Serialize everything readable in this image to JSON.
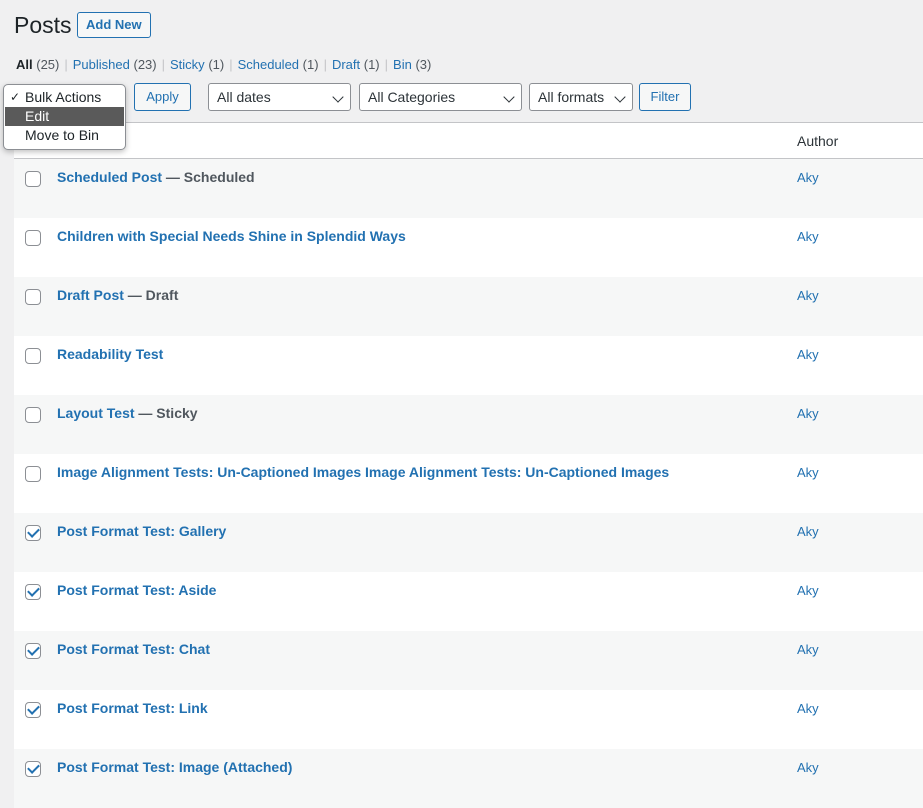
{
  "header": {
    "title": "Posts",
    "add_new": "Add New"
  },
  "views": [
    {
      "label": "All",
      "count": "(25)"
    },
    {
      "label": "Published",
      "count": "(23)"
    },
    {
      "label": "Sticky",
      "count": "(1)"
    },
    {
      "label": "Scheduled",
      "count": "(1)"
    },
    {
      "label": "Draft",
      "count": "(1)"
    },
    {
      "label": "Bin",
      "count": "(3)"
    }
  ],
  "separator": "|",
  "bulk_actions": {
    "options": [
      "Bulk Actions",
      "Edit",
      "Move to Bin"
    ],
    "checked_mark": "✓",
    "highlighted": "Edit"
  },
  "apply_label": "Apply",
  "filters": {
    "dates": "All dates",
    "categories": "All Categories",
    "formats": "All formats",
    "filter_label": "Filter"
  },
  "table": {
    "author_header": "Author",
    "rows": [
      {
        "title": "Scheduled Post",
        "state": " — Scheduled",
        "author": "Aky",
        "checked": false
      },
      {
        "title": "Children with Special Needs Shine in Splendid Ways",
        "state": "",
        "author": "Aky",
        "checked": false
      },
      {
        "title": "Draft Post",
        "state": " — Draft",
        "author": "Aky",
        "checked": false
      },
      {
        "title": "Readability Test",
        "state": "",
        "author": "Aky",
        "checked": false
      },
      {
        "title": "Layout Test",
        "state": " — Sticky",
        "author": "Aky",
        "checked": false
      },
      {
        "title": "Image Alignment Tests: Un-Captioned Images Image Alignment Tests: Un-Captioned Images",
        "state": "",
        "author": "Aky",
        "checked": false
      },
      {
        "title": "Post Format Test: Gallery",
        "state": "",
        "author": "Aky",
        "checked": true
      },
      {
        "title": "Post Format Test: Aside",
        "state": "",
        "author": "Aky",
        "checked": true
      },
      {
        "title": "Post Format Test: Chat",
        "state": "",
        "author": "Aky",
        "checked": true
      },
      {
        "title": "Post Format Test: Link",
        "state": "",
        "author": "Aky",
        "checked": true
      },
      {
        "title": "Post Format Test: Image (Attached)",
        "state": "",
        "author": "Aky",
        "checked": true
      }
    ]
  },
  "colors": {
    "link": "#2271b1",
    "background": "#f0f0f1"
  }
}
